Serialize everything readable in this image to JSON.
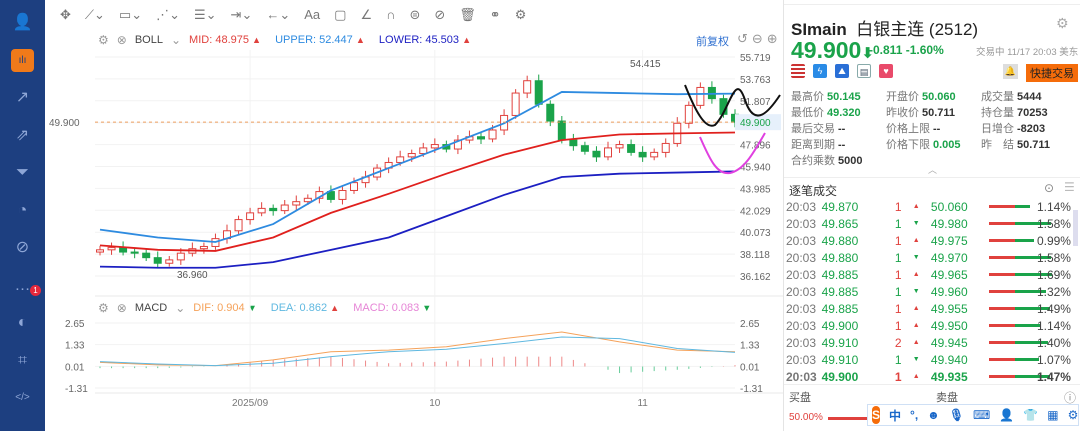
{
  "sidebar": {
    "items": [
      "user",
      "bar-chart",
      "trend",
      "rank",
      "funnel",
      "pie",
      "exchange",
      "chat",
      "moon",
      "gamepad",
      "code"
    ],
    "active": 1,
    "badge": "1"
  },
  "toolbar": {
    "tools": [
      "move",
      "line",
      "rect",
      "path",
      "text-box",
      "range",
      "arrow",
      "Aa",
      "comment",
      "angle",
      "arch",
      "rotate",
      "hide",
      "delete",
      "compare",
      "settings"
    ]
  },
  "boll": {
    "name": "BOLL",
    "mid_label": "MID:",
    "mid": "48.975",
    "upper_label": "UPPER:",
    "upper": "52.447",
    "lower_label": "LOWER:",
    "lower": "45.503",
    "adj": "前复权"
  },
  "macd": {
    "name": "MACD",
    "dif_label": "DIF:",
    "dif": "0.904",
    "dea_label": "DEA:",
    "dea": "0.862",
    "macd_label": "MACD:",
    "macd": "0.083"
  },
  "colors": {
    "up": "#e0413d",
    "down": "#1aa34a",
    "upper": "#2e8be0",
    "mid": "#e0201d",
    "lower": "#1c1fc2",
    "dif": "#f5a25a",
    "dea": "#5fb8e0",
    "hist_macd": "#e685d6"
  },
  "chart_data": {
    "type": "candlestick",
    "y_ticks": [
      "55.719",
      "53.763",
      "51.807",
      "49.900",
      "47.896",
      "45.940",
      "43.985",
      "42.029",
      "40.073",
      "38.118",
      "36.162"
    ],
    "ylim": [
      36.162,
      55.719
    ],
    "x_labels": [
      {
        "label": "2025/09",
        "index": 13
      },
      {
        "label": "10",
        "index": 29
      },
      {
        "label": "11",
        "index": 47
      }
    ],
    "first_open": 38.3,
    "closes": [
      38.5,
      38.7,
      38.3,
      38.2,
      37.8,
      37.3,
      37.6,
      38.2,
      38.6,
      38.8,
      39.5,
      40.2,
      41.2,
      41.8,
      42.2,
      42.0,
      42.5,
      42.8,
      43.1,
      43.7,
      43.0,
      43.8,
      44.5,
      45.0,
      45.8,
      46.3,
      46.8,
      47.1,
      47.6,
      47.9,
      47.5,
      48.3,
      48.6,
      48.4,
      49.2,
      50.5,
      52.5,
      53.6,
      51.5,
      50.0,
      48.3,
      47.8,
      47.3,
      46.8,
      47.6,
      47.9,
      47.2,
      46.8,
      47.2,
      48.0,
      49.8,
      51.4,
      53.0,
      52.0,
      50.6,
      49.9
    ],
    "boll_upper": [
      40.3,
      39.6,
      39.2,
      40.8,
      43.8,
      45.8,
      47.8,
      49.8,
      52.6,
      52.5,
      52.4,
      52.45
    ],
    "boll_mid": [
      38.9,
      38.5,
      38.4,
      39.6,
      41.8,
      43.5,
      45.3,
      47.0,
      48.3,
      48.8,
      48.9,
      48.98
    ],
    "boll_lower": [
      37.0,
      36.9,
      36.9,
      37.4,
      38.5,
      39.6,
      41.5,
      43.4,
      45.0,
      45.3,
      45.4,
      45.5
    ],
    "high_label": "54.415",
    "low_label": "36.960",
    "last_price": "49.900",
    "macd_ticks": [
      "2.65",
      "1.33",
      "0.01",
      "-1.31"
    ],
    "macd_ylim": [
      -1.31,
      2.65
    ],
    "dif": [
      0.25,
      0.1,
      0.05,
      0.4,
      0.9,
      1.0,
      1.2,
      1.7,
      2.1,
      1.5,
      1.0,
      0.9
    ],
    "dea": [
      0.3,
      0.15,
      0.05,
      0.2,
      0.6,
      0.9,
      1.05,
      1.4,
      1.8,
      1.7,
      1.1,
      0.86
    ]
  },
  "quote": {
    "symbol": "SImain",
    "name": "白银主连 (2512)",
    "price": "49.900",
    "change": "-0.811",
    "pct": "-1.60%",
    "status": "交易中 11/17 20:03 美东",
    "quick_trade": "快捷交易",
    "stats": [
      [
        "最高价",
        "50.145",
        true
      ],
      [
        "开盘价",
        "50.060",
        true
      ],
      [
        "成交量",
        "5444",
        false
      ],
      [
        "最低价",
        "49.320",
        true
      ],
      [
        "昨收价",
        "50.711",
        false
      ],
      [
        "持仓量",
        "70253",
        false
      ],
      [
        "最后交易",
        "--",
        false
      ],
      [
        "价格上限",
        "--",
        false
      ],
      [
        "日增仓",
        "-8203",
        false
      ],
      [
        "距离到期",
        "--",
        false
      ],
      [
        "价格下限",
        "0.005",
        true
      ],
      [
        "昨　结",
        "50.711",
        false
      ],
      [
        "合约乘数",
        "5000",
        false
      ]
    ]
  },
  "trades": {
    "title": "逐笔成交",
    "rows": [
      [
        "20:03",
        "49.870",
        "1",
        "up",
        "50.060",
        "1.14%",
        0.45
      ],
      [
        "20:03",
        "49.865",
        "1",
        "down",
        "49.980",
        "1.58%",
        0.98
      ],
      [
        "20:03",
        "49.880",
        "1",
        "up",
        "49.975",
        "0.99%",
        0.55
      ],
      [
        "20:03",
        "49.880",
        "1",
        "down",
        "49.970",
        "1.58%",
        0.98
      ],
      [
        "20:03",
        "49.885",
        "1",
        "up",
        "49.965",
        "1.69%",
        1.0
      ],
      [
        "20:03",
        "49.885",
        "1",
        "down",
        "49.960",
        "1.32%",
        0.85
      ],
      [
        "20:03",
        "49.885",
        "1",
        "up",
        "49.955",
        "1.49%",
        0.95
      ],
      [
        "20:03",
        "49.900",
        "1",
        "up",
        "49.950",
        "1.14%",
        0.7
      ],
      [
        "20:03",
        "49.910",
        "2",
        "up",
        "49.945",
        "1.40%",
        0.9
      ],
      [
        "20:03",
        "49.910",
        "1",
        "down",
        "49.940",
        "1.07%",
        0.68
      ],
      [
        "20:03",
        "49.900",
        "1",
        "up",
        "49.935",
        "1.47%",
        0.95
      ]
    ]
  },
  "book": {
    "bid": "买盘",
    "ask": "卖盘",
    "bid_pct": "50.00%"
  },
  "ime": {
    "lang": "中"
  }
}
